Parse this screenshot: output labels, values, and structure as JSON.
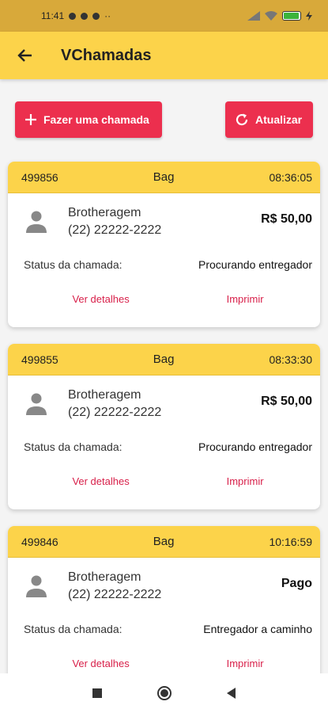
{
  "status_bar": {
    "time": "11:41",
    "battery": "88",
    "battery_level": 0.88
  },
  "appbar": {
    "title": "VChamadas"
  },
  "actions": {
    "add_label": "Fazer uma chamada",
    "refresh_label": "Atualizar"
  },
  "colors": {
    "primary_yellow": "#fcd34a",
    "accent_red": "#ec2f4e",
    "link_red": "#d8204a"
  },
  "status_label": "Status da chamada:",
  "calls": [
    {
      "id": "499856",
      "type": "Bag",
      "time": "08:36:05",
      "client": "Brotheragem",
      "phone": "(22) 22222-2222",
      "price": "R$ 50,00",
      "status": "Procurando entregador",
      "details_label": "Ver detalhes",
      "print_label": "Imprimir"
    },
    {
      "id": "499855",
      "type": "Bag",
      "time": "08:33:30",
      "client": "Brotheragem",
      "phone": "(22) 22222-2222",
      "price": "R$ 50,00",
      "status": "Procurando entregador",
      "details_label": "Ver detalhes",
      "print_label": "Imprimir"
    },
    {
      "id": "499846",
      "type": "Bag",
      "time": "10:16:59",
      "client": "Brotheragem",
      "phone": "(22) 22222-2222",
      "price": "Pago",
      "status": "Entregador a caminho",
      "details_label": "Ver detalhes",
      "print_label": "Imprimir"
    }
  ]
}
